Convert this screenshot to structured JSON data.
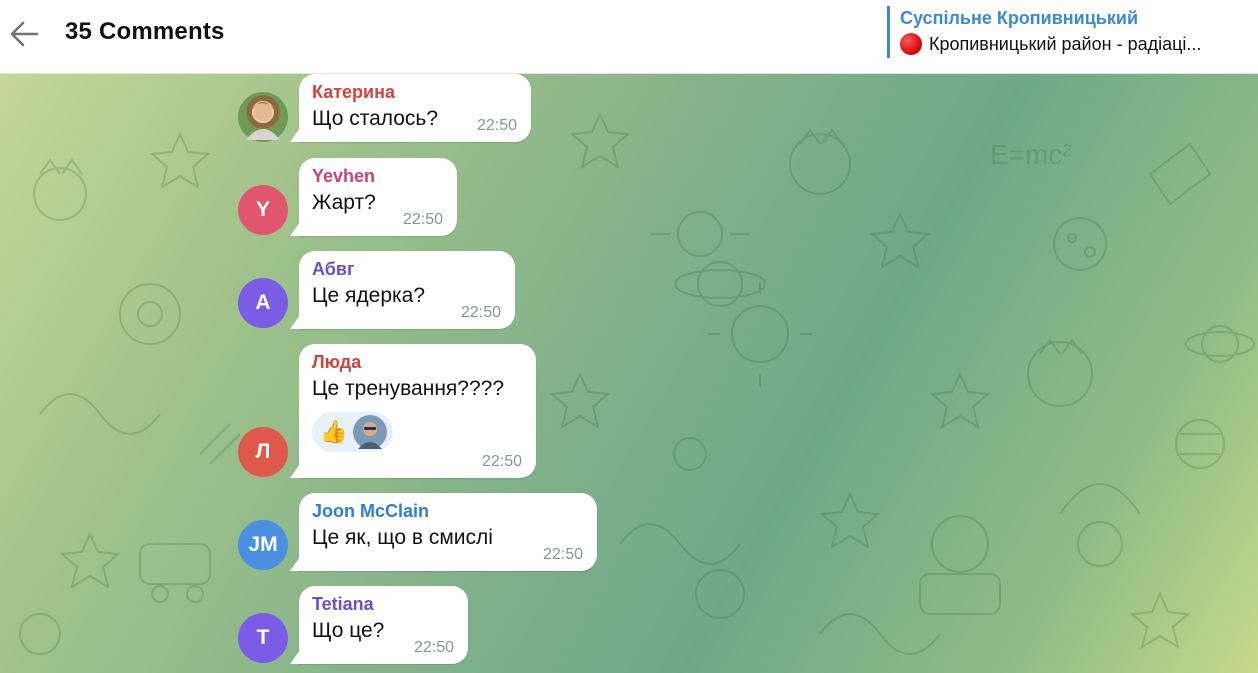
{
  "header": {
    "title": "35 Comments",
    "pinned": {
      "channel": "Суспільне Кропивницький",
      "text": "Кропивницький район - радіаці..."
    }
  },
  "colors": {
    "pinned_accent": "#3a8ad6",
    "yevhen_avatar": "#e0566d",
    "abvh_avatar": "#7a5ce6",
    "lyuda_avatar": "#e0584b",
    "joon_avatar": "#4a8fe0",
    "tetiana_avatar": "#7a5ce6"
  },
  "messages": [
    {
      "author": "Катерина",
      "author_color": "#d2453f",
      "avatar_icon": "photo-avatar-woman",
      "text": "Що сталось?",
      "time": "22:50"
    },
    {
      "author": "Yevhen",
      "author_color": "#c9427a",
      "avatar_initials": "Y",
      "avatar_color": "#e0566d",
      "text": "Жарт?",
      "time": "22:50"
    },
    {
      "author": "Абвг",
      "author_color": "#6b4fd1",
      "avatar_initials": "А",
      "avatar_color": "#7a5ce6",
      "text": "Це ядерка?",
      "time": "22:50"
    },
    {
      "author": "Люда",
      "author_color": "#d2453f",
      "avatar_initials": "Л",
      "avatar_color": "#e0584b",
      "text": "Це тренування????",
      "time": "22:50",
      "reaction": "👍"
    },
    {
      "author": "Joon McClain",
      "author_color": "#2d7ed0",
      "avatar_initials": "JM",
      "avatar_color": "#4a8fe0",
      "text": "Це як, що в смислі",
      "time": "22:50"
    },
    {
      "author": "Tetiana",
      "author_color": "#6b4fd1",
      "avatar_initials": "T",
      "avatar_color": "#7a5ce6",
      "text": "Що це?",
      "time": "22:50"
    }
  ]
}
